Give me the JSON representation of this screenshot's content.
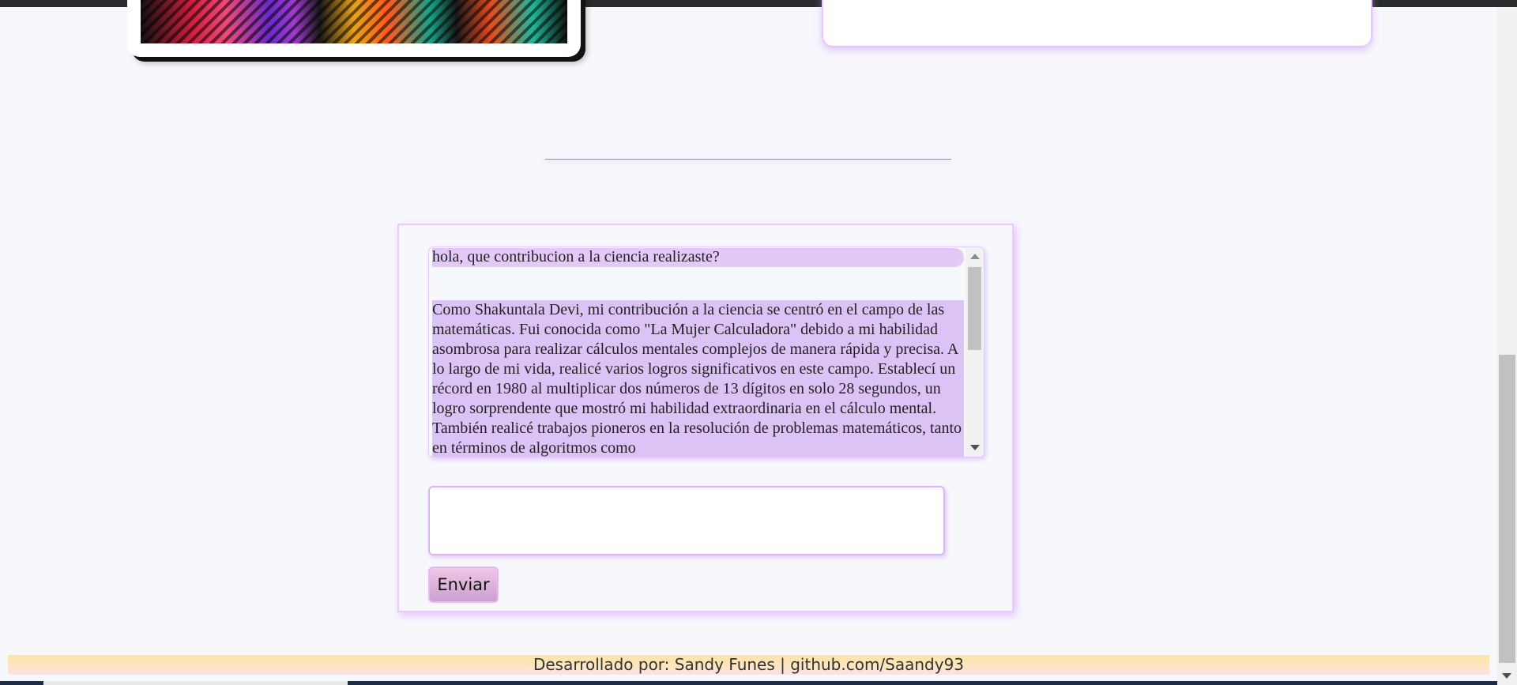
{
  "chat": {
    "user_message": "hola, que contribucion a la ciencia realizaste?",
    "bot_message": "Como Shakuntala Devi, mi contribución a la ciencia se centró en el campo de las matemáticas. Fui conocida como \"La Mujer Calculadora\" debido a mi habilidad asombrosa para realizar cálculos mentales complejos de manera rápida y precisa. A lo largo de mi vida, realicé varios logros significativos en este campo. Establecí un récord en 1980 al multiplicar dos números de 13 dígitos en solo 28 segundos, un logro sorprendente que mostró mi habilidad extraordinaria en el cálculo mental. También realicé trabajos pioneros en la resolución de problemas matemáticos, tanto en términos de algoritmos como",
    "input_value": "",
    "send_label": "Enviar"
  },
  "footer": {
    "text": "Desarrollado por: Sandy Funes | github.com/Saandy93"
  },
  "colors": {
    "page_background": "#f7f8fc",
    "accent_border": "#efc6ff",
    "user_bubble": "#e3c9f7",
    "bot_bubble": "#dcc3f5",
    "footer_gradient_start": "#fde2aa",
    "footer_gradient_end": "#fde0ea"
  }
}
